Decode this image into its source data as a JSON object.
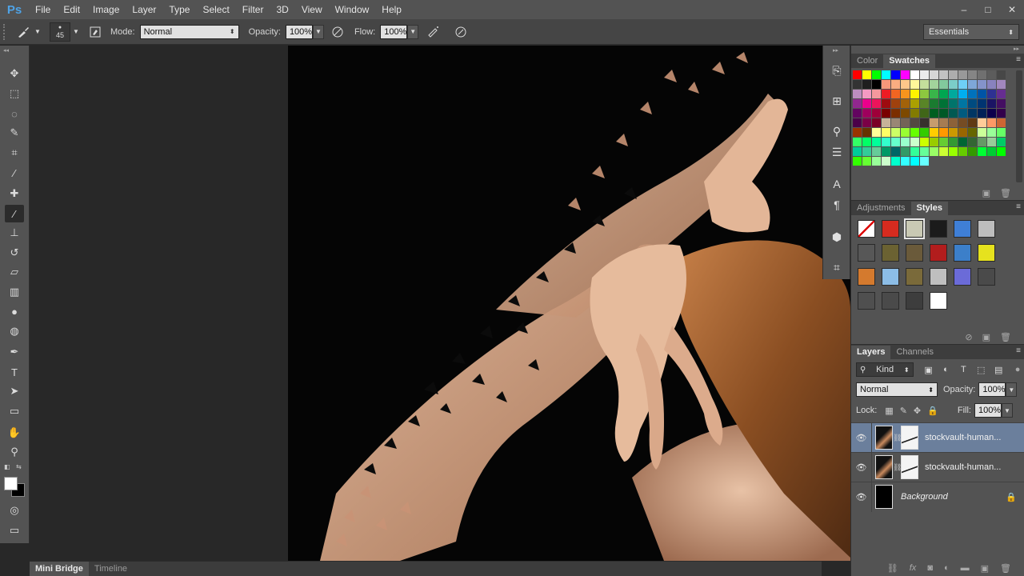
{
  "app": {
    "logo": "Ps"
  },
  "menu": [
    "File",
    "Edit",
    "Image",
    "Layer",
    "Type",
    "Select",
    "Filter",
    "3D",
    "View",
    "Window",
    "Help"
  ],
  "window_controls": [
    "–",
    "□",
    "✕"
  ],
  "options": {
    "brush_size": "45",
    "mode_label": "Mode:",
    "mode_value": "Normal",
    "opacity_label": "Opacity:",
    "opacity_value": "100%",
    "flow_label": "Flow:",
    "flow_value": "100%",
    "workspace": "Essentials"
  },
  "tools": [
    {
      "name": "move-tool",
      "glyph": "✥"
    },
    {
      "name": "marquee-tool",
      "glyph": "⬚"
    },
    {
      "name": "lasso-tool",
      "glyph": "◌"
    },
    {
      "name": "quick-select-tool",
      "glyph": "✎"
    },
    {
      "name": "crop-tool",
      "glyph": "⌗"
    },
    {
      "name": "eyedropper-tool",
      "glyph": "⁄"
    },
    {
      "name": "healing-brush-tool",
      "glyph": "✚"
    },
    {
      "name": "brush-tool",
      "glyph": "∕",
      "active": true
    },
    {
      "name": "clone-stamp-tool",
      "glyph": "⊥"
    },
    {
      "name": "history-brush-tool",
      "glyph": "↺"
    },
    {
      "name": "eraser-tool",
      "glyph": "▱"
    },
    {
      "name": "gradient-tool",
      "glyph": "▥"
    },
    {
      "name": "blur-tool",
      "glyph": "●"
    },
    {
      "name": "dodge-tool",
      "glyph": "◍"
    },
    {
      "name": "pen-tool",
      "glyph": "✒"
    },
    {
      "name": "type-tool",
      "glyph": "T"
    },
    {
      "name": "path-select-tool",
      "glyph": "➤"
    },
    {
      "name": "shape-tool",
      "glyph": "▭"
    },
    {
      "name": "hand-tool",
      "glyph": "✋"
    },
    {
      "name": "zoom-tool",
      "glyph": "⚲"
    }
  ],
  "bottom_tabs": [
    "Mini Bridge",
    "Timeline"
  ],
  "color_panel": {
    "tabs": [
      "Color",
      "Swatches"
    ],
    "active": "Swatches"
  },
  "swatches": [
    "#ff0000",
    "#ffff00",
    "#00ff00",
    "#00ffff",
    "#0000ff",
    "#ff00ff",
    "#ffffff",
    "#ebebeb",
    "#d6d6d6",
    "#c2c2c2",
    "#adadad",
    "#999999",
    "#858585",
    "#707070",
    "#5c5c5c",
    "#474747",
    "#333333",
    "#1f1f1f",
    "#000000",
    "#f7977a",
    "#f9ad81",
    "#fdc68a",
    "#fff79a",
    "#c4df9b",
    "#a2d39c",
    "#82ca9d",
    "#7bcdc8",
    "#6ecff6",
    "#7ea7d8",
    "#8493ca",
    "#8882be",
    "#a187be",
    "#bc8dbf",
    "#f49ac2",
    "#f6989d",
    "#ed1c24",
    "#f26522",
    "#f7941d",
    "#fff200",
    "#8dc73f",
    "#39b54a",
    "#00a651",
    "#00a99d",
    "#00aeef",
    "#0072bc",
    "#0054a6",
    "#2e3192",
    "#662d91",
    "#92278f",
    "#ec008c",
    "#ed145b",
    "#9e0b0f",
    "#a0410d",
    "#a36209",
    "#aba000",
    "#598527",
    "#1a7b30",
    "#007236",
    "#00746b",
    "#0076a3",
    "#004b80",
    "#003471",
    "#1b1464",
    "#440e62",
    "#630460",
    "#9e005d",
    "#9e0039",
    "#790000",
    "#7b2e00",
    "#7d4900",
    "#827b00",
    "#406618",
    "#005e20",
    "#005826",
    "#005952",
    "#005b7f",
    "#003663",
    "#002157",
    "#0d004c",
    "#32004b",
    "#4b0049",
    "#7b0046",
    "#7a0026",
    "#c7b299",
    "#998675",
    "#736357",
    "#534741",
    "#37302d",
    "#c69c6d",
    "#a67c52",
    "#8c6239",
    "#754c24",
    "#603913",
    "#ffcc99",
    "#ff9966",
    "#cc6633",
    "#993300",
    "#663300",
    "#ffff99",
    "#ffff66",
    "#ccff66",
    "#99ff33",
    "#66ff00",
    "#33cc00",
    "#ffcc00",
    "#ff9900",
    "#cc9900",
    "#996600",
    "#666600",
    "#ccff99",
    "#99ff99",
    "#66ff66",
    "#33ff66",
    "#00ff66",
    "#00ff99",
    "#33ffcc",
    "#66ffcc",
    "#99ffcc",
    "#ccffcc",
    "#ccff00",
    "#99cc00",
    "#66cc33",
    "#339933",
    "#006633",
    "#336633",
    "#669966",
    "#99cc99",
    "#00cc66",
    "#00cc99",
    "#33cc99",
    "#66cc99",
    "#009966",
    "#006666",
    "#339966",
    "#33ff99",
    "#66ff99",
    "#99ff66",
    "#ccff33",
    "#99ff00",
    "#66cc00",
    "#339900",
    "#00ff33",
    "#00cc33",
    "#00ff00",
    "#33ff00",
    "#66ff33",
    "#99ff99",
    "#ccffcc",
    "#00ffcc",
    "#33ffff",
    "#00ffff",
    "#66ffff"
  ],
  "styles_panel": {
    "tabs": [
      "Adjustments",
      "Styles"
    ],
    "active": "Styles"
  },
  "styles": [
    "none",
    "#d62b1f",
    "#c9c9b4",
    "#1b1b1b",
    "#3f7fd6",
    "#bdbdbd",
    "#575757",
    "#6b6232",
    "#6a5a3a",
    "#b21d1d",
    "#3c7fc9",
    "#e6e21e",
    "#d47a2e",
    "#8cbde6",
    "#7a6a3a",
    "#bfbfbf",
    "#6b6bd8",
    "#4a4a4a",
    "#4f4f4f",
    "#4a4a4a",
    "#3d3d3d",
    "#ffffff"
  ],
  "layers_panel": {
    "tabs": [
      "Layers",
      "Channels"
    ],
    "active": "Layers",
    "filter_kind": "Kind",
    "blend_mode": "Normal",
    "opacity_label": "Opacity:",
    "opacity_value": "100%",
    "lock_label": "Lock:",
    "fill_label": "Fill:",
    "fill_value": "100%",
    "layers": [
      {
        "name": "stockvault-human...",
        "selected": true,
        "has_mask": true
      },
      {
        "name": "stockvault-human...",
        "selected": false,
        "has_mask": true
      },
      {
        "name": "Background",
        "selected": false,
        "has_mask": false,
        "italic": true,
        "locked": true
      }
    ],
    "footer_icons": [
      "link-icon",
      "fx-icon",
      "mask-icon",
      "adjustment-icon",
      "folder-icon",
      "new-layer-icon",
      "trash-icon"
    ]
  }
}
